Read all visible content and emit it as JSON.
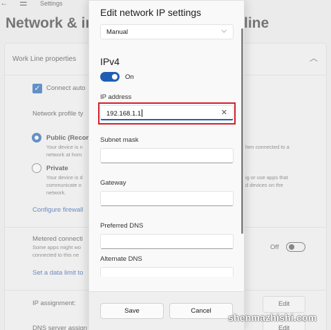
{
  "background": {
    "app_title": "Settings",
    "heading_left": "Network & in",
    "heading_right": "line",
    "panel_title": "Work Line properties",
    "connect_auto": "Connect auto",
    "network_profile": "Network profile ty",
    "public_label": "Public (Recor",
    "public_desc_1": "Your device is n",
    "public_desc_2": "network at hom",
    "public_desc_right": "hen connected to a",
    "private_label": "Private",
    "private_desc_1": "Your device is d",
    "private_desc_2": "communicate o",
    "private_desc_3": "network.",
    "private_desc_right_1": "ig or use apps that",
    "private_desc_right_2": "d devices on the",
    "configure_firewall": "Configure firewall",
    "metered_title": "Metered connecti",
    "metered_desc_1": "Some apps might wo",
    "metered_desc_2": "connected to this ne",
    "metered_state": "Off",
    "data_limit_link": "Set a data limit to",
    "ip_assignment": "IP assignment:",
    "dns_assignment": "DNS server assign",
    "edit_label": "Edit",
    "edit_label_2": "Edit"
  },
  "dialog": {
    "title": "Edit network IP settings",
    "mode_selected": "Manual",
    "section": "IPv4",
    "toggle_label": "On",
    "ip_label": "IP address",
    "ip_value": "192.168.1.1",
    "subnet_label": "Subnet mask",
    "subnet_value": "",
    "gateway_label": "Gateway",
    "gateway_value": "",
    "preferred_dns_label": "Preferred DNS",
    "preferred_dns_value": "",
    "alternate_dns_label": "Alternate DNS",
    "alternate_dns_value": "",
    "save_label": "Save",
    "cancel_label": "Cancel"
  },
  "watermark": "shenmazhishi.com",
  "colors": {
    "accent": "#1f5fb3",
    "highlight": "#d21f2a"
  }
}
